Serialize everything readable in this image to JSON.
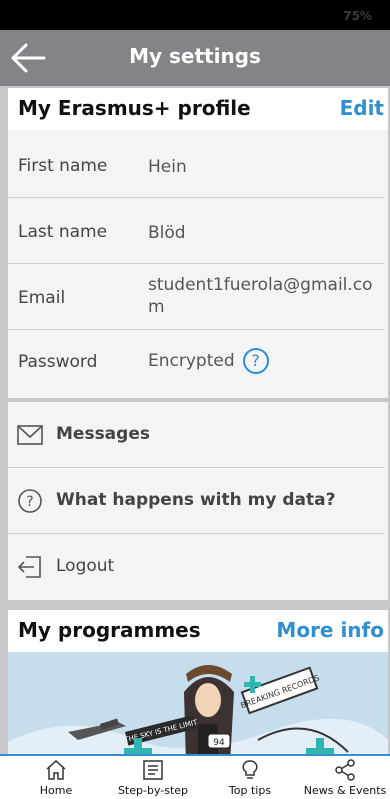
{
  "status": {
    "battery_text": "75%"
  },
  "header": {
    "title": "My settings"
  },
  "profile": {
    "title": "My Erasmus+ profile",
    "edit_label": "Edit",
    "fields": [
      {
        "label": "First name",
        "value": "Hein"
      },
      {
        "label": "Last name",
        "value": "Blöd"
      },
      {
        "label": "Email",
        "value": "student1fuerola@gmail.com"
      },
      {
        "label": "Password",
        "value": "Encrypted"
      }
    ],
    "help_glyph": "?"
  },
  "menu": {
    "messages": "Messages",
    "data_info": "What happens with my data?",
    "logout": "Logout"
  },
  "programmes": {
    "title": "My programmes",
    "more_label": "More info",
    "image_texts": {
      "record": "BREAKING RECORDS",
      "sky": "THE SKY IS THE LIMIT",
      "number": "94"
    }
  },
  "nav": [
    {
      "label": "Home",
      "icon": "home-icon"
    },
    {
      "label": "Step-by-step",
      "icon": "list-icon"
    },
    {
      "label": "Top tips",
      "icon": "lightbulb-icon"
    },
    {
      "label": "News & Events",
      "icon": "share-icon"
    }
  ],
  "colors": {
    "accent": "#2f8fd0",
    "header": "#838487"
  }
}
